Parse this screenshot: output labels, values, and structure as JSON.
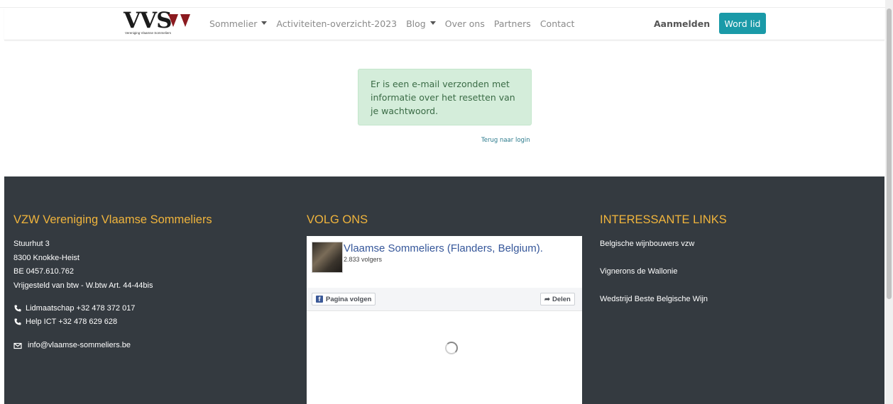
{
  "logo": {
    "text": "VVS",
    "subtitle": "Vereniging Vlaamse Sommeliers"
  },
  "nav": {
    "items": [
      {
        "label": "Sommelier",
        "dropdown": true
      },
      {
        "label": "Activiteiten-overzicht-2023",
        "dropdown": false
      },
      {
        "label": "Blog",
        "dropdown": true
      },
      {
        "label": "Over ons",
        "dropdown": false
      },
      {
        "label": "Partners",
        "dropdown": false
      },
      {
        "label": "Contact",
        "dropdown": false
      }
    ],
    "login_label": "Aanmelden",
    "join_label": "Word lid"
  },
  "alert": {
    "message": "Er is een e-mail verzonden met informatie over het resetten van je wachtwoord.",
    "back_link": "Terug naar login"
  },
  "footer": {
    "about": {
      "heading": "VZW Vereniging Vlaamse Sommeliers",
      "address_line1": "Stuurhut 3",
      "address_line2": "8300 Knokke-Heist",
      "vat": "BE 0457.610.762",
      "vat_note": "Vrijgesteld van btw - W.btw Art. 44-44bis",
      "phone_membership": "Lidmaatschap +32 478 372 017",
      "phone_help": "Help ICT +32 478 629 628",
      "email": "info@vlaamse-sommeliers.be"
    },
    "follow": {
      "heading": "VOLG ONS",
      "page_name": "Vlaamse Sommeliers (Flanders, Belgium).",
      "followers": "2.833 volgers",
      "follow_button": "Pagina volgen",
      "share_button": "Delen"
    },
    "links": {
      "heading": "INTERESSANTE LINKS",
      "items": [
        "Belgische wijnbouwers vzw",
        "Vignerons de Wallonie",
        "Wedstrijd Beste Belgische Wijn"
      ]
    }
  },
  "colors": {
    "accent": "#f0b43c",
    "join_button": "#1a9aa8",
    "footer_bg": "#343a40",
    "alert_bg": "#d4edda"
  }
}
